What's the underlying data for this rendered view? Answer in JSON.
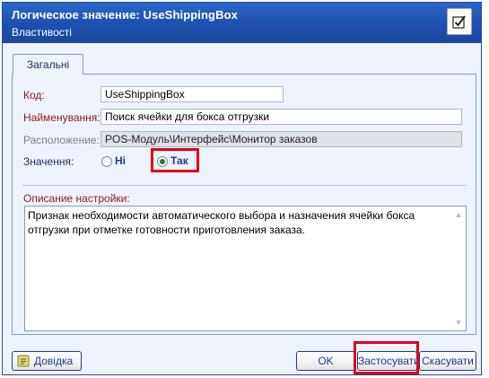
{
  "window": {
    "title": "Логическое значение:  UseShippingBox",
    "subtitle": "Властивості",
    "header_icon": "checkbox-icon"
  },
  "tabs": [
    {
      "label": "Загальні",
      "active": true
    }
  ],
  "form": {
    "code": {
      "label": "Код:",
      "value": "UseShippingBox"
    },
    "name": {
      "label": "Найменування:",
      "value": "Поиск ячейки для бокса отгрузки"
    },
    "location": {
      "label": "Расположение:",
      "value": "POS-Модуль\\Интерфейс\\Монитор заказов"
    },
    "value": {
      "label": "Значення:",
      "options": [
        {
          "label": "Ні",
          "selected": false
        },
        {
          "label": "Так",
          "selected": true
        }
      ]
    },
    "description": {
      "label": "Описание настройки:",
      "text": "Признак необходимости автоматического выбора и назначения ячейки бокса отгрузки при отметке готовности приготовления заказа."
    }
  },
  "buttons": {
    "help": "Довідка",
    "ok": "OK",
    "apply": "Застосувати",
    "cancel": "Скасувати"
  },
  "colors": {
    "header": "#1d4fac",
    "highlight": "#e0001a",
    "label_red": "#8b1a1a",
    "button_text": "#1c3c8c"
  }
}
